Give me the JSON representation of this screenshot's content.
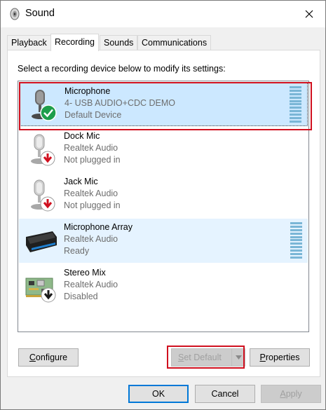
{
  "window": {
    "title": "Sound"
  },
  "tabs": [
    {
      "label": "Playback",
      "active": false
    },
    {
      "label": "Recording",
      "active": true
    },
    {
      "label": "Sounds",
      "active": false
    },
    {
      "label": "Communications",
      "active": false
    }
  ],
  "instruction": "Select a recording device below to modify its settings:",
  "devices": [
    {
      "name": "Microphone",
      "description": "4- USB AUDIO+CDC DEMO",
      "status": "Default Device",
      "icon": "microphone-icon",
      "badge": "green-check-badge",
      "selected": true,
      "meter": true
    },
    {
      "name": "Dock Mic",
      "description": "Realtek Audio",
      "status": "Not plugged in",
      "icon": "microphone-icon",
      "badge": "red-down-arrow-badge",
      "selected": false,
      "meter": false
    },
    {
      "name": "Jack Mic",
      "description": "Realtek Audio",
      "status": "Not plugged in",
      "icon": "microphone-icon",
      "badge": "red-down-arrow-badge",
      "selected": false,
      "meter": false
    },
    {
      "name": "Microphone Array",
      "description": "Realtek Audio",
      "status": "Ready",
      "icon": "microphone-array-icon",
      "badge": "",
      "selected": false,
      "meter": true
    },
    {
      "name": "Stereo Mix",
      "description": "Realtek Audio",
      "status": "Disabled",
      "icon": "circuit-board-icon",
      "badge": "black-down-arrow-badge",
      "selected": false,
      "meter": false
    }
  ],
  "buttons": {
    "configure": "Configure",
    "set_default": "Set Default",
    "properties": "Properties",
    "ok": "OK",
    "cancel": "Cancel",
    "apply": "Apply"
  },
  "colors": {
    "selection": "#cce8ff",
    "highlight_frame": "#d0101f",
    "meter": "#7ab6d6",
    "accent": "#0078d7"
  }
}
